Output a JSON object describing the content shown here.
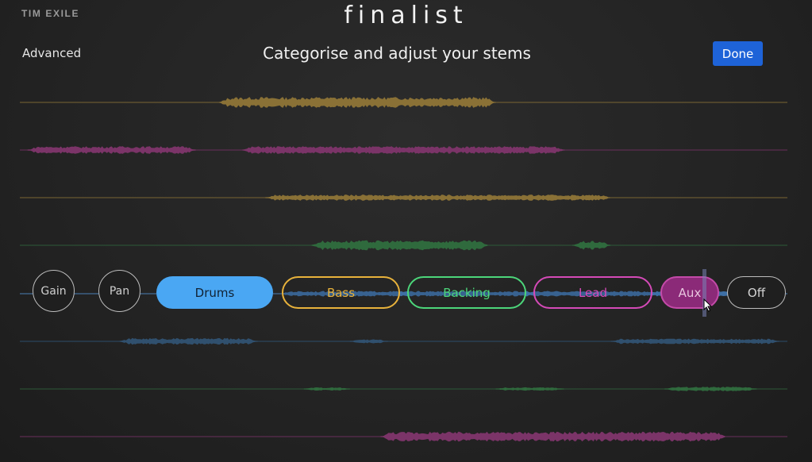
{
  "header": {
    "brand": "TIM EXILE",
    "app_title": "finalist",
    "advanced_label": "Advanced",
    "subtitle": "Categorise and adjust your stems",
    "done_label": "Done"
  },
  "controls": {
    "gain_label": "Gain",
    "pan_label": "Pan",
    "categories": [
      {
        "label": "Drums",
        "color": "#4aa7f3",
        "selected": true
      },
      {
        "label": "Bass",
        "color": "#e8b23b",
        "selected": false
      },
      {
        "label": "Backing",
        "color": "#4cd67a",
        "selected": false
      },
      {
        "label": "Lead",
        "color": "#d54ab8",
        "selected": false
      },
      {
        "label": "Aux",
        "color": "#c34aa8",
        "selected": false,
        "hovered": true
      },
      {
        "label": "Off",
        "color": "#bdbdbd",
        "selected": false
      }
    ]
  },
  "tracks": [
    {
      "line_color": "#7a6533",
      "wave_color": "#8a7136",
      "segments": [
        [
          0.26,
          0.62,
          1.0
        ]
      ]
    },
    {
      "line_color": "#6a2f5c",
      "wave_color": "#7b3468",
      "segments": [
        [
          0.01,
          0.23,
          0.7
        ],
        [
          0.29,
          0.71,
          0.7
        ]
      ]
    },
    {
      "line_color": "#7a6533",
      "wave_color": "#8a7136",
      "segments": [
        [
          0.32,
          0.77,
          0.55
        ]
      ]
    },
    {
      "line_color": "#2d5a38",
      "wave_color": "#2f6a3d",
      "segments": [
        [
          0.38,
          0.61,
          0.9
        ],
        [
          0.72,
          0.77,
          0.8
        ]
      ]
    },
    {
      "line_color": "#4a7fb5",
      "wave_color": "#3e6fa5",
      "segments": [
        [
          0.34,
          0.94,
          0.5
        ]
      ]
    },
    {
      "line_color": "#2d4d6a",
      "wave_color": "#30506e",
      "segments": [
        [
          0.13,
          0.31,
          0.6
        ],
        [
          0.43,
          0.48,
          0.4
        ],
        [
          0.77,
          0.99,
          0.5
        ]
      ]
    },
    {
      "line_color": "#2d5a38",
      "wave_color": "#2f6a3d",
      "segments": [
        [
          0.37,
          0.43,
          0.3
        ],
        [
          0.62,
          0.71,
          0.3
        ],
        [
          0.84,
          0.96,
          0.4
        ]
      ]
    },
    {
      "line_color": "#6a2f5c",
      "wave_color": "#7b3468",
      "segments": [
        [
          0.47,
          0.92,
          0.9
        ]
      ]
    }
  ]
}
